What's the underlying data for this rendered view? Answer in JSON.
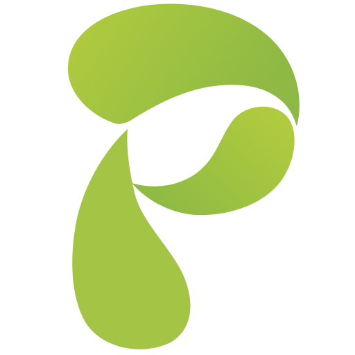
{
  "logo": {
    "name": "green-leaf-p-logo",
    "shape": "stylized letter P formed by three leaf petals",
    "colors": {
      "background": "#ffffff",
      "green_light": "#b3cc3e",
      "green_mid": "#a3c445",
      "green_dark": "#8db944"
    }
  }
}
